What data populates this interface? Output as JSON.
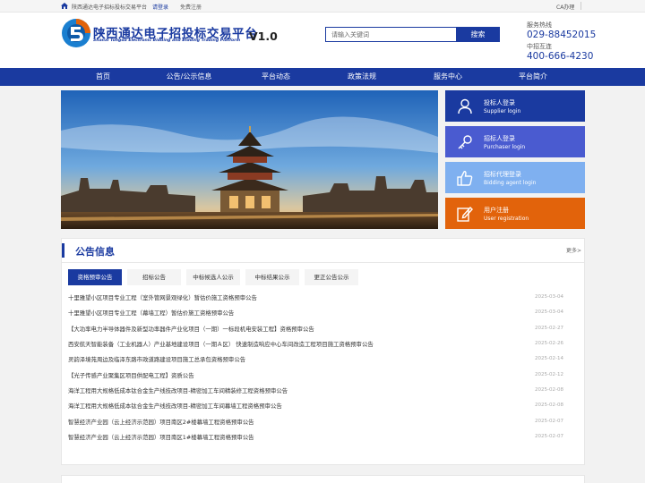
{
  "topbar": {
    "site_name": "陕西通达电子招标投标交易平台",
    "login": "请登录",
    "register": "免费注册",
    "ca": "CA办理"
  },
  "header": {
    "title": "陕西通达电子招投标交易平台",
    "subtitle": "Shanxi Tongda Electronic Bidding and Bidding Trading Platform",
    "version": "V1.0"
  },
  "search": {
    "placeholder": "请输入关键词",
    "button": "搜索"
  },
  "contact": {
    "hotline_label": "服务热线",
    "hotline": "029-88452015",
    "zhongzhao_label": "中招互连",
    "zhongzhao": "400-666-4230"
  },
  "nav": [
    "首页",
    "公告/公示信息",
    "平台动态",
    "政策法规",
    "服务中心",
    "平台简介"
  ],
  "login_cards": [
    {
      "cn": "投标人登录",
      "en": "Supplier login",
      "color": "#1a3aa0",
      "icon": "user-icon"
    },
    {
      "cn": "招标人登录",
      "en": "Purchaser login",
      "color": "#4a5bd0",
      "icon": "key-icon"
    },
    {
      "cn": "招标代理登录",
      "en": "Bidding agent login",
      "color": "#7fb0f0",
      "icon": "thumbs-up-icon"
    },
    {
      "cn": "用户注册",
      "en": "User registration",
      "color": "#e2630b",
      "icon": "edit-icon"
    }
  ],
  "notices": {
    "title": "公告信息",
    "more": "更多>",
    "tabs": [
      "资格预审公告",
      "招标公告",
      "中标候选人公示",
      "中标结果公示",
      "更正公告公示"
    ],
    "active_tab": 0,
    "rows": [
      {
        "title": "十里雅望小区项目专业工程（室外管网景观绿化）暂估价施工资格预审公告",
        "date": "2025-03-04"
      },
      {
        "title": "十里雅望小区项目专业工程（幕墙工程）暂估价施工资格预审公告",
        "date": "2025-03-04"
      },
      {
        "title": "【大功率电力半导体器件及新型功率器件产业化项目（一期）一标段机电安装工程】资格预审公告",
        "date": "2025-02-27"
      },
      {
        "title": "西安航天智能装备（工业机器人）产业基地建设项目（一期Ａ区） 快速制造响应中心车间改造工程项目施工资格预审公告",
        "date": "2025-02-26"
      },
      {
        "title": "灵韵泽境苑周边及临泽东路市政道路建设项目施工总承包资格预审公告",
        "date": "2025-02-14"
      },
      {
        "title": "【光子传感产业聚集区项目供配电工程】资质公告",
        "date": "2025-02-12"
      },
      {
        "title": "海洋工程用大规格低成本钛合金生产线技改项目-精密加工车间精装修工程资格预审公告",
        "date": "2025-02-08"
      },
      {
        "title": "海洋工程用大规格低成本钛合金生产线技改项目-精密加工车间幕墙工程资格预审公告",
        "date": "2025-02-08"
      },
      {
        "title": "智慧经济产业园（云上经济示范园）项目南区2#楼幕墙工程资格预审公告",
        "date": "2025-02-07"
      },
      {
        "title": "智慧经济产业园（云上经济示范园）项目南区1#楼幕墙工程资格预审公告",
        "date": "2025-02-07"
      }
    ]
  },
  "colors": {
    "brand": "#1a3aa0",
    "accent_orange": "#e2630b"
  }
}
